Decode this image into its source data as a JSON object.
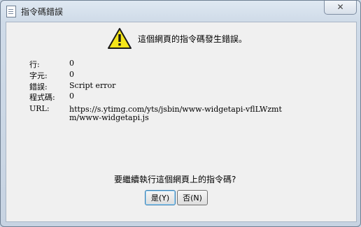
{
  "window": {
    "title": "指令碼錯誤",
    "close_label": "✕"
  },
  "dialog": {
    "header_message": "這個網頁的指令碼發生錯誤。",
    "fields": [
      {
        "label": "行:",
        "value": "0"
      },
      {
        "label": "字元:",
        "value": "0"
      },
      {
        "label": "錯誤:",
        "value": "Script error"
      },
      {
        "label": "程式碼:",
        "value": "0"
      },
      {
        "label": "URL:",
        "value": "https://s.ytimg.com/yts/jsbin/www-widgetapi-vflLWzmtm/www-widgetapi.js"
      }
    ],
    "question": "要繼續執行這個網頁上的指令碼?",
    "yes_label": "是(Y)",
    "no_label": "否(N)"
  },
  "icons": {
    "title": "document-icon",
    "warning": "warning-icon",
    "warning_color": "#f5e61a"
  }
}
